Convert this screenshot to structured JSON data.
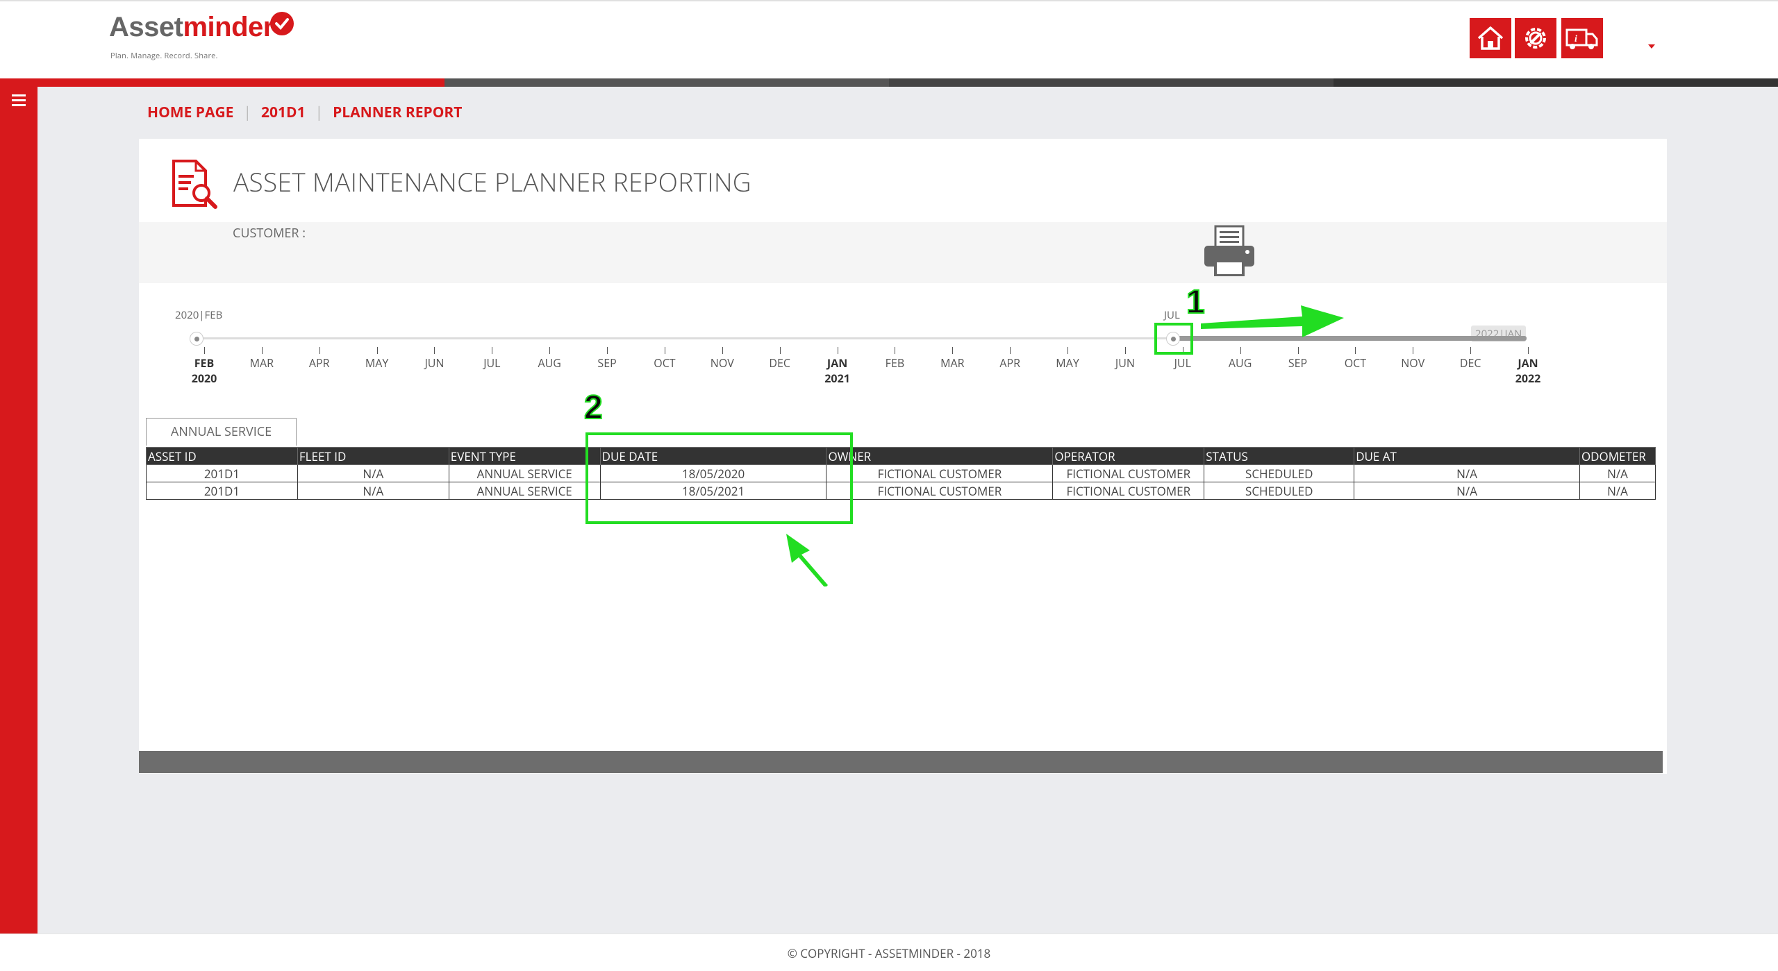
{
  "brand": {
    "part1": "Asset",
    "part2": "minder",
    "tagline": "Plan. Manage. Record. Share."
  },
  "header": {
    "buttons": [
      {
        "icon": "home-icon",
        "color": "#d7191c"
      },
      {
        "icon": "gear-wrench-icon",
        "color": "#d7191c"
      },
      {
        "icon": "truck-info-icon",
        "color": "#d7191c"
      }
    ]
  },
  "colors": {
    "accent": "#d7191c",
    "strip": [
      "#d7191c",
      "#555555",
      "#444444",
      "#333333"
    ],
    "annotation": "#22dd22"
  },
  "breadcrumb": {
    "home": "HOME PAGE",
    "asset": "201D1",
    "report": "PLANNER REPORT"
  },
  "page": {
    "title": "ASSET MAINTENANCE PLANNER REPORTING",
    "customer_label": "CUSTOMER :"
  },
  "timeline": {
    "start_label": "2020|FEB",
    "handle_label": "JUL",
    "end_label": "2022|JAN",
    "selected_start": "2021-07",
    "selected_end": "2022-01",
    "months": [
      "FEB",
      "MAR",
      "APR",
      "MAY",
      "JUN",
      "JUL",
      "AUG",
      "SEP",
      "OCT",
      "NOV",
      "DEC",
      "JAN",
      "FEB",
      "MAR",
      "APR",
      "MAY",
      "JUN",
      "JUL",
      "AUG",
      "SEP",
      "OCT",
      "NOV",
      "DEC",
      "JAN"
    ],
    "years": [
      {
        "index": 0,
        "label": "2020"
      },
      {
        "index": 11,
        "label": "2021"
      },
      {
        "index": 23,
        "label": "2022"
      }
    ]
  },
  "tab": {
    "label": "ANNUAL SERVICE"
  },
  "table": {
    "columns": [
      "ASSET ID",
      "FLEET ID",
      "EVENT TYPE",
      "DUE DATE",
      "OWNER",
      "OPERATOR",
      "STATUS",
      "DUE AT",
      "ODOMETER"
    ],
    "rows": [
      [
        "201D1",
        "N/A",
        "ANNUAL SERVICE",
        "18/05/2020",
        "FICTIONAL CUSTOMER",
        "FICTIONAL CUSTOMER",
        "SCHEDULED",
        "N/A",
        "N/A"
      ],
      [
        "201D1",
        "N/A",
        "ANNUAL SERVICE",
        "18/05/2021",
        "FICTIONAL CUSTOMER",
        "FICTIONAL CUSTOMER",
        "SCHEDULED",
        "N/A",
        "N/A"
      ]
    ]
  },
  "annotations": {
    "one": "1",
    "two": "2"
  },
  "footer": {
    "copyright": "© COPYRIGHT - ASSETMINDER - 2018"
  }
}
